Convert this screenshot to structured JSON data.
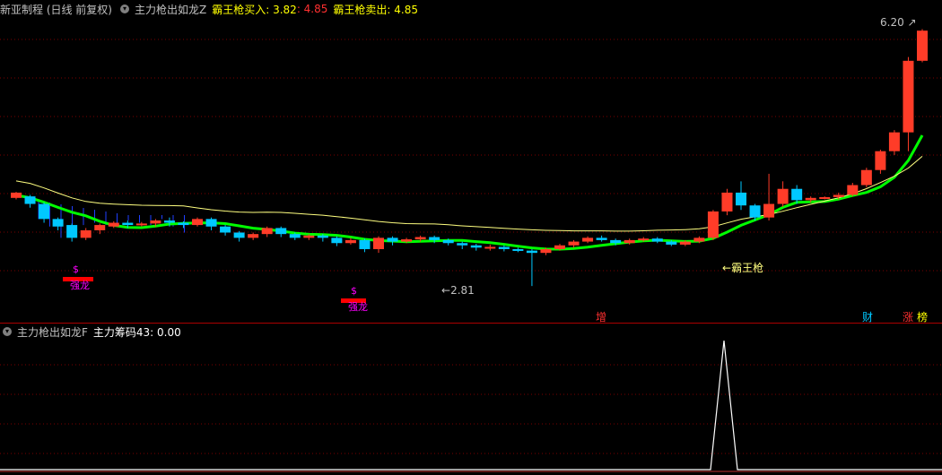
{
  "main_panel": {
    "stock_title": "新亚制程 (日线 前复权)",
    "indicator_name": "主力枪出如龙Z",
    "buy_label": "霸王枪买入: 3.82",
    "sep_value": ": 4.85",
    "sell_label": "霸王枪卖出: 4.85",
    "high_price_label": "6.20",
    "low_price_label": "2.81",
    "signal_label": "霸王枪",
    "signal_markers": [
      {
        "symbol": "$",
        "text": "强龙"
      },
      {
        "symbol": "$",
        "text": "强龙"
      }
    ],
    "bottom_tags": [
      "增",
      "财",
      "涨",
      "榜"
    ],
    "colors": {
      "up": "#ff3c28",
      "down": "#00c8ff",
      "line_green": "#00ff00",
      "ma": "#ffff80",
      "signal": "#ff00ff"
    }
  },
  "sub_panel": {
    "indicator_name": "主力枪出如龙F",
    "value_label": "主力筹码43: 0.00"
  },
  "chart_data": {
    "type": "candlestick",
    "ymax_visible": 6.2,
    "ymin_visible": 2.81,
    "candles": [
      [
        3.98,
        4.05,
        3.96,
        4.06
      ],
      [
        4.0,
        3.9,
        3.85,
        4.02
      ],
      [
        3.9,
        3.7,
        3.65,
        3.92
      ],
      [
        3.7,
        3.6,
        3.55,
        3.72
      ],
      [
        3.62,
        3.45,
        3.4,
        3.64
      ],
      [
        3.45,
        3.55,
        3.42,
        3.58
      ],
      [
        3.55,
        3.62,
        3.5,
        3.64
      ],
      [
        3.6,
        3.65,
        3.58,
        3.67
      ],
      [
        3.65,
        3.62,
        3.58,
        3.68
      ],
      [
        3.62,
        3.64,
        3.6,
        3.66
      ],
      [
        3.64,
        3.68,
        3.6,
        3.7
      ],
      [
        3.68,
        3.65,
        3.6,
        3.72
      ],
      [
        3.65,
        3.62,
        3.58,
        3.67
      ],
      [
        3.62,
        3.7,
        3.6,
        3.72
      ],
      [
        3.7,
        3.6,
        3.55,
        3.72
      ],
      [
        3.6,
        3.52,
        3.48,
        3.62
      ],
      [
        3.52,
        3.45,
        3.4,
        3.54
      ],
      [
        3.45,
        3.5,
        3.42,
        3.52
      ],
      [
        3.5,
        3.58,
        3.46,
        3.6
      ],
      [
        3.58,
        3.5,
        3.46,
        3.6
      ],
      [
        3.5,
        3.45,
        3.42,
        3.52
      ],
      [
        3.45,
        3.48,
        3.42,
        3.5
      ],
      [
        3.48,
        3.45,
        3.4,
        3.5
      ],
      [
        3.45,
        3.38,
        3.34,
        3.47
      ],
      [
        3.38,
        3.42,
        3.36,
        3.45
      ],
      [
        3.42,
        3.3,
        3.26,
        3.44
      ],
      [
        3.3,
        3.45,
        3.25,
        3.47
      ],
      [
        3.45,
        3.4,
        3.35,
        3.47
      ],
      [
        3.4,
        3.43,
        3.38,
        3.45
      ],
      [
        3.43,
        3.46,
        3.4,
        3.48
      ],
      [
        3.46,
        3.42,
        3.38,
        3.48
      ],
      [
        3.42,
        3.38,
        3.35,
        3.44
      ],
      [
        3.38,
        3.35,
        3.3,
        3.4
      ],
      [
        3.35,
        3.32,
        3.28,
        3.37
      ],
      [
        3.32,
        3.33,
        3.28,
        3.36
      ],
      [
        3.33,
        3.3,
        3.27,
        3.35
      ],
      [
        3.3,
        3.28,
        3.26,
        3.32
      ],
      [
        3.28,
        3.25,
        2.81,
        3.3
      ],
      [
        3.25,
        3.3,
        3.22,
        3.32
      ],
      [
        3.3,
        3.35,
        3.28,
        3.37
      ],
      [
        3.35,
        3.4,
        3.32,
        3.42
      ],
      [
        3.4,
        3.45,
        3.38,
        3.47
      ],
      [
        3.45,
        3.42,
        3.4,
        3.48
      ],
      [
        3.42,
        3.38,
        3.35,
        3.44
      ],
      [
        3.38,
        3.42,
        3.36,
        3.44
      ],
      [
        3.42,
        3.44,
        3.4,
        3.46
      ],
      [
        3.44,
        3.4,
        3.38,
        3.46
      ],
      [
        3.4,
        3.36,
        3.34,
        3.42
      ],
      [
        3.36,
        3.4,
        3.34,
        3.42
      ],
      [
        3.4,
        3.45,
        3.38,
        3.47
      ],
      [
        3.45,
        3.8,
        3.42,
        3.82
      ],
      [
        3.8,
        4.05,
        3.75,
        4.1
      ],
      [
        4.05,
        3.88,
        3.82,
        4.2
      ],
      [
        3.88,
        3.72,
        3.68,
        3.9
      ],
      [
        3.72,
        3.9,
        3.68,
        4.3
      ],
      [
        3.9,
        4.1,
        3.86,
        4.2
      ],
      [
        4.1,
        3.95,
        3.9,
        4.15
      ],
      [
        3.95,
        3.98,
        3.92,
        4.0
      ],
      [
        3.98,
        3.99,
        3.96,
        4.0
      ],
      [
        3.99,
        4.02,
        3.96,
        4.05
      ],
      [
        4.02,
        4.15,
        4.0,
        4.18
      ],
      [
        4.15,
        4.35,
        4.12,
        4.38
      ],
      [
        4.35,
        4.6,
        4.3,
        4.62
      ],
      [
        4.6,
        4.85,
        4.55,
        4.88
      ],
      [
        4.85,
        5.8,
        4.6,
        5.85
      ],
      [
        5.8,
        6.2,
        5.78,
        6.22
      ]
    ]
  }
}
